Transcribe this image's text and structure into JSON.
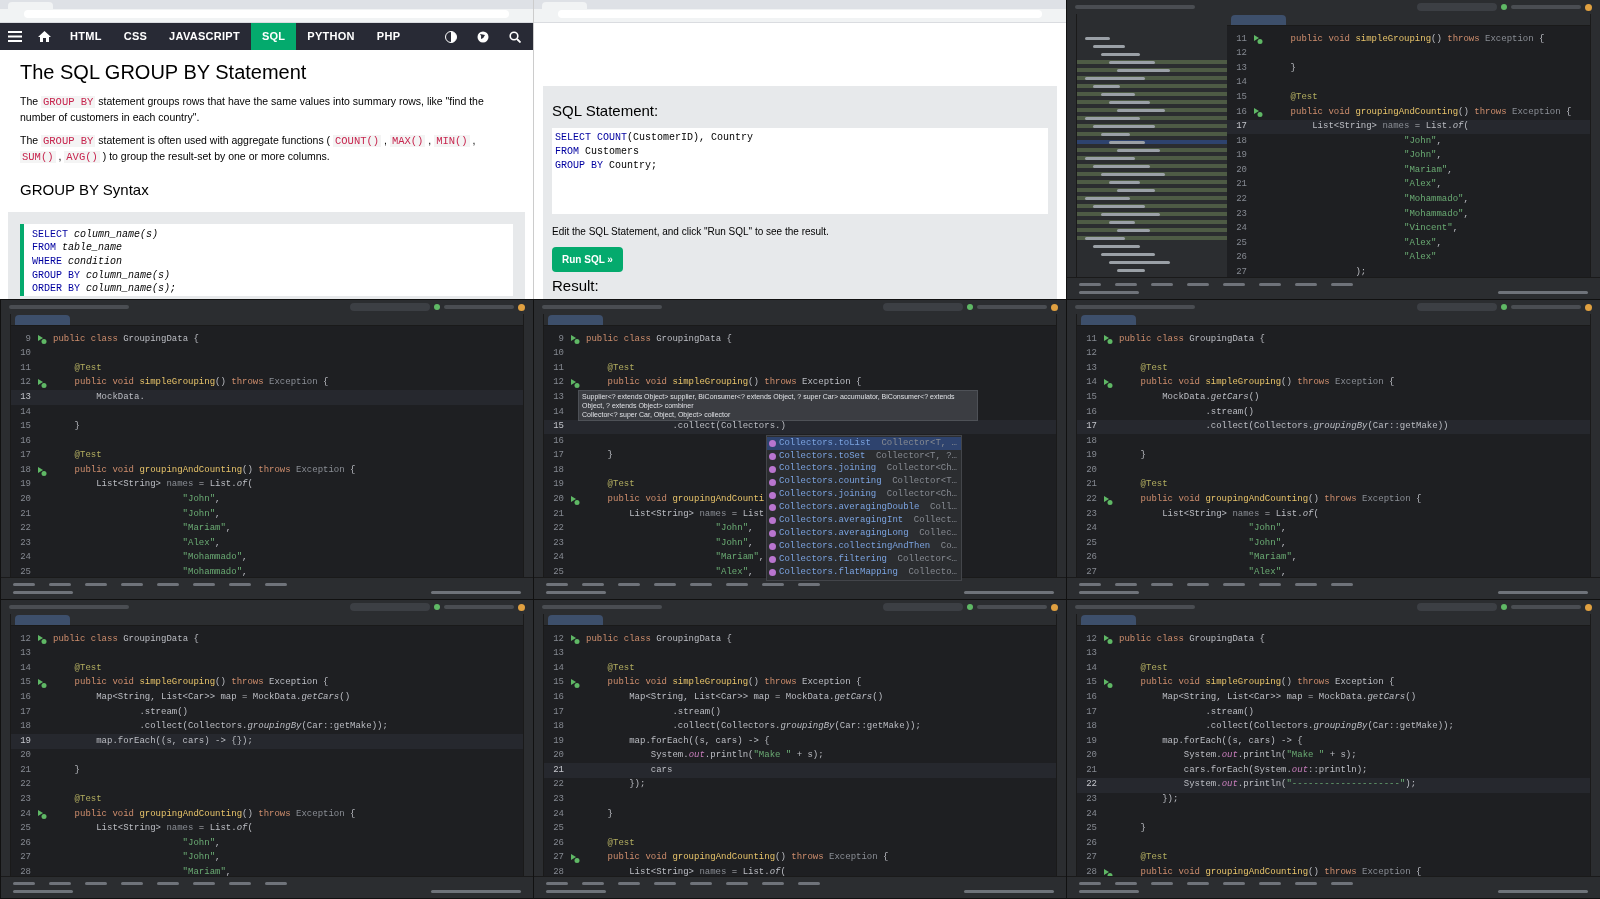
{
  "panels": [
    {
      "kind": "web-tutorial",
      "nav": [
        {
          "label": "HTML",
          "selected": false
        },
        {
          "label": "CSS",
          "selected": false
        },
        {
          "label": "JAVASCRIPT",
          "selected": false
        },
        {
          "label": "SQL",
          "selected": true
        },
        {
          "label": "PYTHON",
          "selected": false
        },
        {
          "label": "PHP",
          "selected": false
        }
      ],
      "title": "The SQL GROUP BY Statement",
      "paragraphs": [
        [
          {
            "t": "The "
          },
          {
            "t": "GROUP BY",
            "code": true
          },
          {
            "t": " statement groups rows that have the same values into summary rows, like \"find the number of customers in each country\"."
          }
        ],
        [
          {
            "t": "The "
          },
          {
            "t": "GROUP BY",
            "code": true
          },
          {
            "t": " statement is often used with aggregate functions ( "
          },
          {
            "t": "COUNT()",
            "code": true
          },
          {
            "t": " , "
          },
          {
            "t": "MAX()",
            "code": true
          },
          {
            "t": " , "
          },
          {
            "t": "MIN()",
            "code": true
          },
          {
            "t": " , "
          },
          {
            "t": "SUM()",
            "code": true
          },
          {
            "t": " , "
          },
          {
            "t": "AVG()",
            "code": true
          },
          {
            "t": " ) to group the result-set by one or more columns."
          }
        ]
      ],
      "subtitle": "GROUP BY Syntax",
      "syntax": [
        [
          {
            "t": "SELECT ",
            "kind": "keyword"
          },
          {
            "t": "column_name(s)",
            "kind": "placeholder"
          }
        ],
        [
          {
            "t": "FROM ",
            "kind": "keyword"
          },
          {
            "t": "table_name",
            "kind": "placeholder"
          }
        ],
        [
          {
            "t": "WHERE ",
            "kind": "keyword"
          },
          {
            "t": "condition",
            "kind": "placeholder"
          }
        ],
        [
          {
            "t": "GROUP BY ",
            "kind": "keyword"
          },
          {
            "t": "column_name(s)",
            "kind": "placeholder"
          }
        ],
        [
          {
            "t": "ORDER BY ",
            "kind": "keyword"
          },
          {
            "t": "column_name(s);",
            "kind": "placeholder"
          }
        ]
      ]
    },
    {
      "kind": "web-tryit",
      "heading": "SQL Statement:",
      "sql": [
        [
          {
            "t": "SELECT ",
            "kind": "keyword"
          },
          {
            "t": "COUNT",
            "kind": "keyword"
          },
          {
            "t": "(CustomerID), Country",
            "kind": "plain"
          }
        ],
        [
          {
            "t": "FROM ",
            "kind": "keyword"
          },
          {
            "t": "Customers",
            "kind": "plain"
          }
        ],
        [
          {
            "t": "GROUP BY ",
            "kind": "keyword"
          },
          {
            "t": "Country;",
            "kind": "plain"
          }
        ]
      ],
      "note": "Edit the SQL Statement, and click \"Run SQL\" to see the result.",
      "button": "Run SQL »",
      "result_heading": "Result:"
    },
    {
      "kind": "ide",
      "tree_visible": true,
      "lines": [
        {
          "n": "11",
          "run": true,
          "code": [
            {
              "t": "    public void ",
              "kind": "keyword"
            },
            {
              "t": "simpleGrouping",
              "kind": "method"
            },
            {
              "t": "() ",
              "kind": "plain"
            },
            {
              "t": "throws ",
              "kind": "keyword"
            },
            {
              "t": "Exception ",
              "kind": "unused"
            },
            {
              "t": "{",
              "kind": "plain"
            }
          ]
        },
        {
          "n": "12"
        },
        {
          "n": "13",
          "code": [
            {
              "t": "    }",
              "kind": "plain"
            }
          ]
        },
        {
          "n": "14"
        },
        {
          "n": "15",
          "code": [
            {
              "t": "    @Test",
              "kind": "annotation"
            }
          ]
        },
        {
          "n": "16",
          "run": true,
          "code": [
            {
              "t": "    public void ",
              "kind": "keyword"
            },
            {
              "t": "groupingAndCounting",
              "kind": "method"
            },
            {
              "t": "() ",
              "kind": "plain"
            },
            {
              "t": "throws ",
              "kind": "keyword"
            },
            {
              "t": "Exception ",
              "kind": "unused"
            },
            {
              "t": "{",
              "kind": "plain"
            }
          ]
        },
        {
          "n": "17",
          "current": true,
          "code": [
            {
              "t": "        List<String> ",
              "kind": "plain"
            },
            {
              "t": "names",
              "kind": "unused"
            },
            {
              "t": " = List.",
              "kind": "plain"
            },
            {
              "t": "of",
              "kind": "static"
            },
            {
              "t": "(",
              "kind": "plain"
            }
          ]
        },
        {
          "n": "18",
          "code": [
            {
              "t": "                         \"John\"",
              "kind": "string"
            },
            {
              "t": ",",
              "kind": "plain"
            }
          ]
        },
        {
          "n": "19",
          "code": [
            {
              "t": "                         \"John\"",
              "kind": "string"
            },
            {
              "t": ",",
              "kind": "plain"
            }
          ]
        },
        {
          "n": "20",
          "code": [
            {
              "t": "                         \"Mariam\"",
              "kind": "string"
            },
            {
              "t": ",",
              "kind": "plain"
            }
          ]
        },
        {
          "n": "21",
          "code": [
            {
              "t": "                         \"Alex\"",
              "kind": "string"
            },
            {
              "t": ",",
              "kind": "plain"
            }
          ]
        },
        {
          "n": "22",
          "code": [
            {
              "t": "                         \"Mohammado\"",
              "kind": "string"
            },
            {
              "t": ",",
              "kind": "plain"
            }
          ]
        },
        {
          "n": "23",
          "code": [
            {
              "t": "                         \"Mohammado\"",
              "kind": "string"
            },
            {
              "t": ",",
              "kind": "plain"
            }
          ]
        },
        {
          "n": "24",
          "code": [
            {
              "t": "                         \"Vincent\"",
              "kind": "string"
            },
            {
              "t": ",",
              "kind": "plain"
            }
          ]
        },
        {
          "n": "25",
          "code": [
            {
              "t": "                         \"Alex\"",
              "kind": "string"
            },
            {
              "t": ",",
              "kind": "plain"
            }
          ]
        },
        {
          "n": "26",
          "code": [
            {
              "t": "                         \"Alex\"",
              "kind": "string"
            }
          ]
        },
        {
          "n": "27",
          "code": [
            {
              "t": "                );",
              "kind": "plain"
            }
          ]
        }
      ]
    },
    {
      "kind": "ide",
      "lines": [
        {
          "n": "9",
          "run": true,
          "code": [
            {
              "t": "public class ",
              "kind": "keyword"
            },
            {
              "t": "GroupingData {",
              "kind": "plain"
            }
          ]
        },
        {
          "n": "10"
        },
        {
          "n": "11",
          "code": [
            {
              "t": "    @Test",
              "kind": "annotation"
            }
          ]
        },
        {
          "n": "12",
          "run": true,
          "code": [
            {
              "t": "    public void ",
              "kind": "keyword"
            },
            {
              "t": "simpleGrouping",
              "kind": "method"
            },
            {
              "t": "() ",
              "kind": "plain"
            },
            {
              "t": "throws ",
              "kind": "keyword"
            },
            {
              "t": "Exception ",
              "kind": "unused"
            },
            {
              "t": "{",
              "kind": "plain"
            }
          ]
        },
        {
          "n": "13",
          "current": true,
          "code": [
            {
              "t": "        MockData.",
              "kind": "plain"
            }
          ]
        },
        {
          "n": "14"
        },
        {
          "n": "15",
          "code": [
            {
              "t": "    }",
              "kind": "plain"
            }
          ]
        },
        {
          "n": "16"
        },
        {
          "n": "17",
          "code": [
            {
              "t": "    @Test",
              "kind": "annotation"
            }
          ]
        },
        {
          "n": "18",
          "run": true,
          "code": [
            {
              "t": "    public void ",
              "kind": "keyword"
            },
            {
              "t": "groupingAndCounting",
              "kind": "method"
            },
            {
              "t": "() ",
              "kind": "plain"
            },
            {
              "t": "throws ",
              "kind": "keyword"
            },
            {
              "t": "Exception ",
              "kind": "unused"
            },
            {
              "t": "{",
              "kind": "plain"
            }
          ]
        },
        {
          "n": "19",
          "code": [
            {
              "t": "        List<String> ",
              "kind": "plain"
            },
            {
              "t": "names",
              "kind": "unused"
            },
            {
              "t": " = List.",
              "kind": "plain"
            },
            {
              "t": "of",
              "kind": "static"
            },
            {
              "t": "(",
              "kind": "plain"
            }
          ]
        },
        {
          "n": "20",
          "code": [
            {
              "t": "                        \"John\"",
              "kind": "string"
            },
            {
              "t": ",",
              "kind": "plain"
            }
          ]
        },
        {
          "n": "21",
          "code": [
            {
              "t": "                        \"John\"",
              "kind": "string"
            },
            {
              "t": ",",
              "kind": "plain"
            }
          ]
        },
        {
          "n": "22",
          "code": [
            {
              "t": "                        \"Mariam\"",
              "kind": "string"
            },
            {
              "t": ",",
              "kind": "plain"
            }
          ]
        },
        {
          "n": "23",
          "code": [
            {
              "t": "                        \"Alex\"",
              "kind": "string"
            },
            {
              "t": ",",
              "kind": "plain"
            }
          ]
        },
        {
          "n": "24",
          "code": [
            {
              "t": "                        \"Mohammado\"",
              "kind": "string"
            },
            {
              "t": ",",
              "kind": "plain"
            }
          ]
        },
        {
          "n": "25",
          "code": [
            {
              "t": "                        \"Mohammado\"",
              "kind": "string"
            },
            {
              "t": ",",
              "kind": "plain"
            }
          ]
        }
      ]
    },
    {
      "kind": "ide",
      "lines": [
        {
          "n": "9",
          "run": true,
          "code": [
            {
              "t": "public class ",
              "kind": "keyword"
            },
            {
              "t": "GroupingData {",
              "kind": "plain"
            }
          ]
        },
        {
          "n": "10"
        },
        {
          "n": "11",
          "code": [
            {
              "t": "    @Test",
              "kind": "annotation"
            }
          ]
        },
        {
          "n": "12",
          "run": true,
          "code": [
            {
              "t": "    public void ",
              "kind": "keyword"
            },
            {
              "t": "simpleGrouping",
              "kind": "method"
            },
            {
              "t": "() ",
              "kind": "plain"
            },
            {
              "t": "throws ",
              "kind": "keyword"
            },
            {
              "t": "Exception {",
              "kind": "plain"
            }
          ]
        },
        {
          "n": "13"
        },
        {
          "n": "14"
        },
        {
          "n": "15",
          "current": true,
          "code": [
            {
              "t": "                .collect(Collectors.",
              "kind": "plain"
            },
            {
              "t": ")",
              "kind": "plain"
            }
          ]
        },
        {
          "n": "16"
        },
        {
          "n": "17",
          "code": [
            {
              "t": "    }",
              "kind": "plain"
            }
          ]
        },
        {
          "n": "18"
        },
        {
          "n": "19",
          "code": [
            {
              "t": "    @Test",
              "kind": "annotation"
            }
          ]
        },
        {
          "n": "20",
          "run": true,
          "code": [
            {
              "t": "    public void ",
              "kind": "keyword"
            },
            {
              "t": "groupingAndCounti",
              "kind": "method"
            }
          ]
        },
        {
          "n": "21",
          "code": [
            {
              "t": "        List<String> ",
              "kind": "plain"
            },
            {
              "t": "names",
              "kind": "unused"
            },
            {
              "t": " = List",
              "kind": "plain"
            }
          ]
        },
        {
          "n": "22",
          "code": [
            {
              "t": "                        \"John\"",
              "kind": "string"
            },
            {
              "t": ",",
              "kind": "plain"
            }
          ]
        },
        {
          "n": "23",
          "code": [
            {
              "t": "                        \"John\"",
              "kind": "string"
            },
            {
              "t": ",",
              "kind": "plain"
            }
          ]
        },
        {
          "n": "24",
          "code": [
            {
              "t": "                        \"Mariam\"",
              "kind": "string"
            },
            {
              "t": ",",
              "kind": "plain"
            }
          ]
        },
        {
          "n": "25",
          "code": [
            {
              "t": "                        \"Alex\"",
              "kind": "string"
            },
            {
              "t": ",",
              "kind": "plain"
            }
          ]
        }
      ],
      "tooltip": [
        "Supplier<? extends Object> supplier, BiConsumer<? extends Object, ? super Car> accumulator, BiConsumer<? extends Object, ? extends Object> combiner",
        "Collector<? super Car, Object, Object> collector"
      ],
      "completions": [
        {
          "name": "Collectors.toList",
          "type": "Collector<T, …",
          "selected": true
        },
        {
          "name": "Collectors.toSet",
          "type": "Collector<T, ?…",
          "selected": false
        },
        {
          "name": "Collectors.joining",
          "type": "Collector<Ch…",
          "selected": false
        },
        {
          "name": "Collectors.counting",
          "type": "Collector<T…",
          "selected": false
        },
        {
          "name": "Collectors.joining",
          "type": "Collector<Ch…",
          "selected": false
        },
        {
          "name": "Collectors.averagingDouble",
          "type": "Coll…",
          "selected": false
        },
        {
          "name": "Collectors.averagingInt",
          "type": "Collect…",
          "selected": false
        },
        {
          "name": "Collectors.averagingLong",
          "type": "Collec…",
          "selected": false
        },
        {
          "name": "Collectors.collectingAndThen",
          "type": "Co…",
          "selected": false
        },
        {
          "name": "Collectors.filtering",
          "type": "Collector<…",
          "selected": false
        },
        {
          "name": "Collectors.flatMapping",
          "type": "Collecto…",
          "selected": false
        }
      ]
    },
    {
      "kind": "ide",
      "lines": [
        {
          "n": "11",
          "run": true,
          "code": [
            {
              "t": "public class ",
              "kind": "keyword"
            },
            {
              "t": "GroupingData {",
              "kind": "plain"
            }
          ]
        },
        {
          "n": "12"
        },
        {
          "n": "13",
          "code": [
            {
              "t": "    @Test",
              "kind": "annotation"
            }
          ]
        },
        {
          "n": "14",
          "run": true,
          "code": [
            {
              "t": "    public void ",
              "kind": "keyword"
            },
            {
              "t": "simpleGrouping",
              "kind": "method"
            },
            {
              "t": "() ",
              "kind": "plain"
            },
            {
              "t": "throws ",
              "kind": "keyword"
            },
            {
              "t": "Exception ",
              "kind": "unused"
            },
            {
              "t": "{",
              "kind": "plain"
            }
          ]
        },
        {
          "n": "15",
          "code": [
            {
              "t": "        MockData.",
              "kind": "plain"
            },
            {
              "t": "getCars",
              "kind": "static"
            },
            {
              "t": "()",
              "kind": "plain"
            }
          ]
        },
        {
          "n": "16",
          "code": [
            {
              "t": "                .stream()",
              "kind": "plain"
            }
          ]
        },
        {
          "n": "17",
          "current": true,
          "code": [
            {
              "t": "                .collect(Collectors.",
              "kind": "plain"
            },
            {
              "t": "groupingBy",
              "kind": "static"
            },
            {
              "t": "(Car::getMake))",
              "kind": "plain"
            }
          ]
        },
        {
          "n": "18"
        },
        {
          "n": "19",
          "code": [
            {
              "t": "    }",
              "kind": "plain"
            }
          ]
        },
        {
          "n": "20"
        },
        {
          "n": "21",
          "code": [
            {
              "t": "    @Test",
              "kind": "annotation"
            }
          ]
        },
        {
          "n": "22",
          "run": true,
          "code": [
            {
              "t": "    public void ",
              "kind": "keyword"
            },
            {
              "t": "groupingAndCounting",
              "kind": "method"
            },
            {
              "t": "() ",
              "kind": "plain"
            },
            {
              "t": "throws ",
              "kind": "keyword"
            },
            {
              "t": "Exception ",
              "kind": "unused"
            },
            {
              "t": "{",
              "kind": "plain"
            }
          ]
        },
        {
          "n": "23",
          "code": [
            {
              "t": "        List<String> ",
              "kind": "plain"
            },
            {
              "t": "names",
              "kind": "unused"
            },
            {
              "t": " = List.",
              "kind": "plain"
            },
            {
              "t": "of",
              "kind": "static"
            },
            {
              "t": "(",
              "kind": "plain"
            }
          ]
        },
        {
          "n": "24",
          "code": [
            {
              "t": "                        \"John\"",
              "kind": "string"
            },
            {
              "t": ",",
              "kind": "plain"
            }
          ]
        },
        {
          "n": "25",
          "code": [
            {
              "t": "                        \"John\"",
              "kind": "string"
            },
            {
              "t": ",",
              "kind": "plain"
            }
          ]
        },
        {
          "n": "26",
          "code": [
            {
              "t": "                        \"Mariam\"",
              "kind": "string"
            },
            {
              "t": ",",
              "kind": "plain"
            }
          ]
        },
        {
          "n": "27",
          "code": [
            {
              "t": "                        \"Alex\"",
              "kind": "string"
            },
            {
              "t": ",",
              "kind": "plain"
            }
          ]
        }
      ]
    },
    {
      "kind": "ide",
      "lines": [
        {
          "n": "12",
          "run": true,
          "code": [
            {
              "t": "public class ",
              "kind": "keyword"
            },
            {
              "t": "GroupingData {",
              "kind": "plain"
            }
          ]
        },
        {
          "n": "13"
        },
        {
          "n": "14",
          "code": [
            {
              "t": "    @Test",
              "kind": "annotation"
            }
          ]
        },
        {
          "n": "15",
          "run": true,
          "code": [
            {
              "t": "    public void ",
              "kind": "keyword"
            },
            {
              "t": "simpleGrouping",
              "kind": "method"
            },
            {
              "t": "() ",
              "kind": "plain"
            },
            {
              "t": "throws ",
              "kind": "keyword"
            },
            {
              "t": "Exception {",
              "kind": "plain"
            }
          ]
        },
        {
          "n": "16",
          "code": [
            {
              "t": "        Map<String, List<Car>> map = MockData.",
              "kind": "plain"
            },
            {
              "t": "getCars",
              "kind": "static"
            },
            {
              "t": "()",
              "kind": "plain"
            }
          ]
        },
        {
          "n": "17",
          "code": [
            {
              "t": "                .stream()",
              "kind": "plain"
            }
          ]
        },
        {
          "n": "18",
          "code": [
            {
              "t": "                .collect(Collectors.",
              "kind": "plain"
            },
            {
              "t": "groupingBy",
              "kind": "static"
            },
            {
              "t": "(Car::getMake));",
              "kind": "plain"
            }
          ]
        },
        {
          "n": "19",
          "current": true,
          "code": [
            {
              "t": "        map.forEach((s, cars) -> {});",
              "kind": "plain"
            }
          ]
        },
        {
          "n": "20"
        },
        {
          "n": "21",
          "code": [
            {
              "t": "    }",
              "kind": "plain"
            }
          ]
        },
        {
          "n": "22"
        },
        {
          "n": "23",
          "code": [
            {
              "t": "    @Test",
              "kind": "annotation"
            }
          ]
        },
        {
          "n": "24",
          "run": true,
          "code": [
            {
              "t": "    public void ",
              "kind": "keyword"
            },
            {
              "t": "groupingAndCounting",
              "kind": "method"
            },
            {
              "t": "() ",
              "kind": "plain"
            },
            {
              "t": "throws ",
              "kind": "keyword"
            },
            {
              "t": "Exception ",
              "kind": "unused"
            },
            {
              "t": "{",
              "kind": "plain"
            }
          ]
        },
        {
          "n": "25",
          "code": [
            {
              "t": "        List<String> ",
              "kind": "plain"
            },
            {
              "t": "names",
              "kind": "unused"
            },
            {
              "t": " = List.",
              "kind": "plain"
            },
            {
              "t": "of",
              "kind": "static"
            },
            {
              "t": "(",
              "kind": "plain"
            }
          ]
        },
        {
          "n": "26",
          "code": [
            {
              "t": "                        \"John\"",
              "kind": "string"
            },
            {
              "t": ",",
              "kind": "plain"
            }
          ]
        },
        {
          "n": "27",
          "code": [
            {
              "t": "                        \"John\"",
              "kind": "string"
            },
            {
              "t": ",",
              "kind": "plain"
            }
          ]
        },
        {
          "n": "28",
          "code": [
            {
              "t": "                        \"Mariam\"",
              "kind": "string"
            },
            {
              "t": ",",
              "kind": "plain"
            }
          ]
        }
      ]
    },
    {
      "kind": "ide",
      "lines": [
        {
          "n": "12",
          "run": true,
          "code": [
            {
              "t": "public class ",
              "kind": "keyword"
            },
            {
              "t": "GroupingData {",
              "kind": "plain"
            }
          ]
        },
        {
          "n": "13"
        },
        {
          "n": "14",
          "code": [
            {
              "t": "    @Test",
              "kind": "annotation"
            }
          ]
        },
        {
          "n": "15",
          "run": true,
          "code": [
            {
              "t": "    public void ",
              "kind": "keyword"
            },
            {
              "t": "simpleGrouping",
              "kind": "method"
            },
            {
              "t": "() ",
              "kind": "plain"
            },
            {
              "t": "throws ",
              "kind": "keyword"
            },
            {
              "t": "Exception {",
              "kind": "plain"
            }
          ]
        },
        {
          "n": "16",
          "code": [
            {
              "t": "        Map<String, List<Car>> map = MockData.",
              "kind": "plain"
            },
            {
              "t": "getCars",
              "kind": "static"
            },
            {
              "t": "()",
              "kind": "plain"
            }
          ]
        },
        {
          "n": "17",
          "code": [
            {
              "t": "                .stream()",
              "kind": "plain"
            }
          ]
        },
        {
          "n": "18",
          "code": [
            {
              "t": "                .collect(Collectors.",
              "kind": "plain"
            },
            {
              "t": "groupingBy",
              "kind": "static"
            },
            {
              "t": "(Car::getMake));",
              "kind": "plain"
            }
          ]
        },
        {
          "n": "19",
          "code": [
            {
              "t": "        map.forEach((s, cars) -> {",
              "kind": "plain"
            }
          ]
        },
        {
          "n": "20",
          "code": [
            {
              "t": "            System.",
              "kind": "plain"
            },
            {
              "t": "out",
              "kind": "field"
            },
            {
              "t": ".println(",
              "kind": "plain"
            },
            {
              "t": "\"Make \"",
              "kind": "string"
            },
            {
              "t": " + s);",
              "kind": "plain"
            }
          ]
        },
        {
          "n": "21",
          "current": true,
          "code": [
            {
              "t": "            cars",
              "kind": "plain"
            }
          ]
        },
        {
          "n": "22",
          "code": [
            {
              "t": "        });",
              "kind": "plain"
            }
          ]
        },
        {
          "n": "23"
        },
        {
          "n": "24",
          "code": [
            {
              "t": "    }",
              "kind": "plain"
            }
          ]
        },
        {
          "n": "25"
        },
        {
          "n": "26",
          "code": [
            {
              "t": "    @Test",
              "kind": "annotation"
            }
          ]
        },
        {
          "n": "27",
          "run": true,
          "code": [
            {
              "t": "    public void ",
              "kind": "keyword"
            },
            {
              "t": "groupingAndCounting",
              "kind": "method"
            },
            {
              "t": "() ",
              "kind": "plain"
            },
            {
              "t": "throws ",
              "kind": "keyword"
            },
            {
              "t": "Exception ",
              "kind": "unused"
            },
            {
              "t": "{",
              "kind": "plain"
            }
          ]
        },
        {
          "n": "28",
          "code": [
            {
              "t": "        List<String> ",
              "kind": "plain"
            },
            {
              "t": "names",
              "kind": "unused"
            },
            {
              "t": " = List.",
              "kind": "plain"
            },
            {
              "t": "of",
              "kind": "static"
            },
            {
              "t": "(",
              "kind": "plain"
            }
          ]
        }
      ]
    },
    {
      "kind": "ide",
      "lines": [
        {
          "n": "12",
          "run": true,
          "code": [
            {
              "t": "public class ",
              "kind": "keyword"
            },
            {
              "t": "GroupingData {",
              "kind": "plain"
            }
          ]
        },
        {
          "n": "13"
        },
        {
          "n": "14",
          "code": [
            {
              "t": "    @Test",
              "kind": "annotation"
            }
          ]
        },
        {
          "n": "15",
          "run": true,
          "code": [
            {
              "t": "    public void ",
              "kind": "keyword"
            },
            {
              "t": "simpleGrouping",
              "kind": "method"
            },
            {
              "t": "() ",
              "kind": "plain"
            },
            {
              "t": "throws ",
              "kind": "keyword"
            },
            {
              "t": "Exception {",
              "kind": "plain"
            }
          ]
        },
        {
          "n": "16",
          "code": [
            {
              "t": "        Map<String, List<Car>> map = MockData.",
              "kind": "plain"
            },
            {
              "t": "getCars",
              "kind": "static"
            },
            {
              "t": "()",
              "kind": "plain"
            }
          ]
        },
        {
          "n": "17",
          "code": [
            {
              "t": "                .stream()",
              "kind": "plain"
            }
          ]
        },
        {
          "n": "18",
          "code": [
            {
              "t": "                .collect(Collectors.",
              "kind": "plain"
            },
            {
              "t": "groupingBy",
              "kind": "static"
            },
            {
              "t": "(Car::getMake));",
              "kind": "plain"
            }
          ]
        },
        {
          "n": "19",
          "code": [
            {
              "t": "        map.forEach((s, cars) -> {",
              "kind": "plain"
            }
          ]
        },
        {
          "n": "20",
          "code": [
            {
              "t": "            System.",
              "kind": "plain"
            },
            {
              "t": "out",
              "kind": "field"
            },
            {
              "t": ".println(",
              "kind": "plain"
            },
            {
              "t": "\"Make \"",
              "kind": "string"
            },
            {
              "t": " + s);",
              "kind": "plain"
            }
          ]
        },
        {
          "n": "21",
          "code": [
            {
              "t": "            cars.forEach(System.",
              "kind": "plain"
            },
            {
              "t": "out",
              "kind": "field"
            },
            {
              "t": "::println);",
              "kind": "plain"
            }
          ]
        },
        {
          "n": "22",
          "current": true,
          "code": [
            {
              "t": "            System.",
              "kind": "plain"
            },
            {
              "t": "out",
              "kind": "field"
            },
            {
              "t": ".println(",
              "kind": "plain"
            },
            {
              "t": "\"--------------------\"",
              "kind": "string"
            },
            {
              "t": ");",
              "kind": "plain"
            }
          ]
        },
        {
          "n": "23",
          "code": [
            {
              "t": "        });",
              "kind": "plain"
            }
          ]
        },
        {
          "n": "24"
        },
        {
          "n": "25",
          "code": [
            {
              "t": "    }",
              "kind": "plain"
            }
          ]
        },
        {
          "n": "26"
        },
        {
          "n": "27",
          "code": [
            {
              "t": "    @Test",
              "kind": "annotation"
            }
          ]
        },
        {
          "n": "28",
          "run": true,
          "code": [
            {
              "t": "    public void ",
              "kind": "keyword"
            },
            {
              "t": "groupingAndCounting",
              "kind": "method"
            },
            {
              "t": "() ",
              "kind": "plain"
            },
            {
              "t": "throws ",
              "kind": "keyword"
            },
            {
              "t": "Exception ",
              "kind": "unused"
            },
            {
              "t": "{",
              "kind": "plain"
            }
          ]
        }
      ]
    }
  ]
}
